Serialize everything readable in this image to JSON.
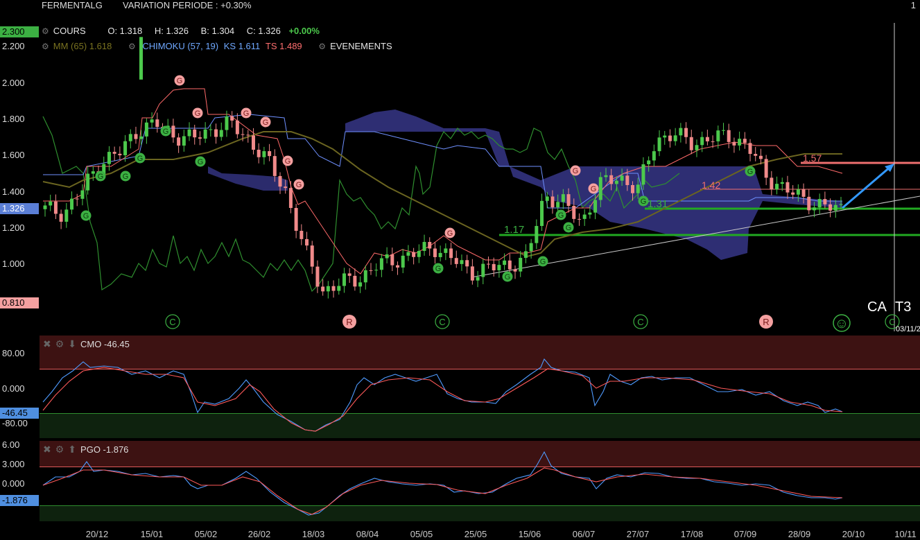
{
  "header": {
    "ticker": "FERMENTALG",
    "variation": "VARIATION PERIODE : +0.30%",
    "page_indicator": "1"
  },
  "legend": {
    "cours_label": "COURS",
    "open": "O: 1.318",
    "high": "H: 1.326",
    "low": "B: 1.304",
    "close": "C: 1.326",
    "change": "+0.00%",
    "mm": "MM (65) 1.618",
    "ichimoku": "ICHIMOKU (57, 19)",
    "ks": "KS 1.611",
    "ts": "TS 1.489",
    "events": "EVENEMENTS"
  },
  "price_axis": {
    "labels": [
      "2.200",
      "2.000",
      "1.800",
      "1.600",
      "1.400",
      "1.200",
      "1.000"
    ],
    "max_badge": "2.300",
    "current_badge": "1.326",
    "min_badge": "0.810"
  },
  "annotations": {
    "level_117": "1.17",
    "level_131": "1.31",
    "level_142": "1.42",
    "level_157": "1.57",
    "ca": "CA",
    "t3": "T3",
    "date_cursor": "03/11/2",
    "event_letters": [
      "C",
      "R",
      "C",
      "C",
      "R",
      "C"
    ],
    "smiley": "☺"
  },
  "cmo": {
    "title": "CMO -46.45",
    "labels": [
      "80.00",
      "0.000",
      "-80.00"
    ],
    "current_badge": "-46.45"
  },
  "pgo": {
    "title": "PGO -1.876",
    "labels": [
      "6.00",
      "3.000",
      "0.000"
    ],
    "current_badge": "-1.876"
  },
  "x_axis": [
    "20/12",
    "15/01",
    "05/02",
    "26/02",
    "18/03",
    "08/04",
    "05/05",
    "25/05",
    "15/06",
    "06/07",
    "27/07",
    "17/08",
    "07/09",
    "28/09",
    "20/10",
    "10/11"
  ],
  "colors": {
    "up": "#4cc94c",
    "down": "#f08a8a",
    "cloud": "#3a3a8c",
    "kijun": "#6699ff",
    "tenkan": "#ff7777",
    "chikou": "#3a9a3a",
    "mm": "#6b6520"
  },
  "chart_data": {
    "type": "candlestick",
    "series": [
      {
        "name": "COURS",
        "values_approx": [
          1.32,
          1.3,
          1.42,
          1.58,
          1.62,
          1.75,
          1.78,
          1.72,
          1.7,
          1.75,
          1.78,
          1.7,
          1.58,
          1.42,
          1.1,
          0.88,
          0.92,
          0.95,
          1.02,
          1.05,
          1.08,
          1.12,
          1.05,
          0.98,
          1.0,
          1.02,
          1.05,
          1.4,
          1.35,
          1.25,
          1.45,
          1.5,
          1.42,
          1.7,
          1.72,
          1.68,
          1.7,
          1.72,
          1.65,
          1.5,
          1.42,
          1.38,
          1.33,
          1.326
        ]
      }
    ],
    "ylim": [
      0.81,
      2.3
    ]
  }
}
